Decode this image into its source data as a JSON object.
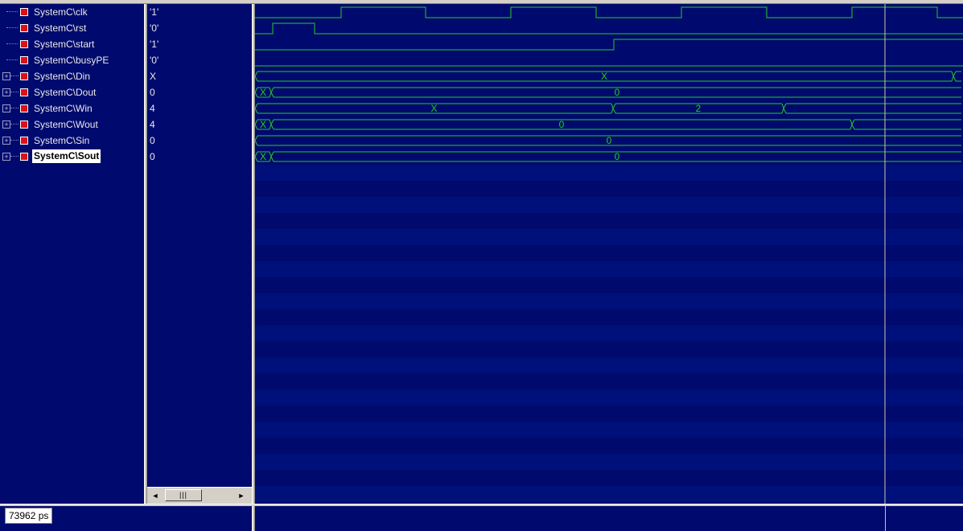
{
  "signals": [
    {
      "name": "SystemC\\clk",
      "value": "'1'",
      "type": "bit",
      "expandable": false
    },
    {
      "name": "SystemC\\rst",
      "value": "'0'",
      "type": "bit",
      "expandable": false
    },
    {
      "name": "SystemC\\start",
      "value": "'1'",
      "type": "bit",
      "expandable": false
    },
    {
      "name": "SystemC\\busyPE",
      "value": "'0'",
      "type": "bit",
      "expandable": false
    },
    {
      "name": "SystemC\\Din",
      "value": "X",
      "type": "bus",
      "expandable": true,
      "labels": [
        "X"
      ]
    },
    {
      "name": "SystemC\\Dout",
      "value": "0",
      "type": "bus",
      "expandable": true,
      "labels": [
        "X",
        "0"
      ]
    },
    {
      "name": "SystemC\\Win",
      "value": "4",
      "type": "bus",
      "expandable": true,
      "labels": [
        "X",
        "2"
      ]
    },
    {
      "name": "SystemC\\Wout",
      "value": "4",
      "type": "bus",
      "expandable": true,
      "labels": [
        "X",
        "0"
      ]
    },
    {
      "name": "SystemC\\Sin",
      "value": "0",
      "type": "bus",
      "expandable": true,
      "labels": [
        "0"
      ]
    },
    {
      "name": "SystemC\\Sout",
      "value": "0",
      "type": "bus",
      "expandable": true,
      "labels": [
        "X",
        "0"
      ],
      "selected": true
    }
  ],
  "cursor_time": "73962 ps",
  "colors": {
    "background": "#000a6e",
    "wave": "#22cc22",
    "cursor": "#c8c8a0",
    "marker": "#e01010"
  }
}
